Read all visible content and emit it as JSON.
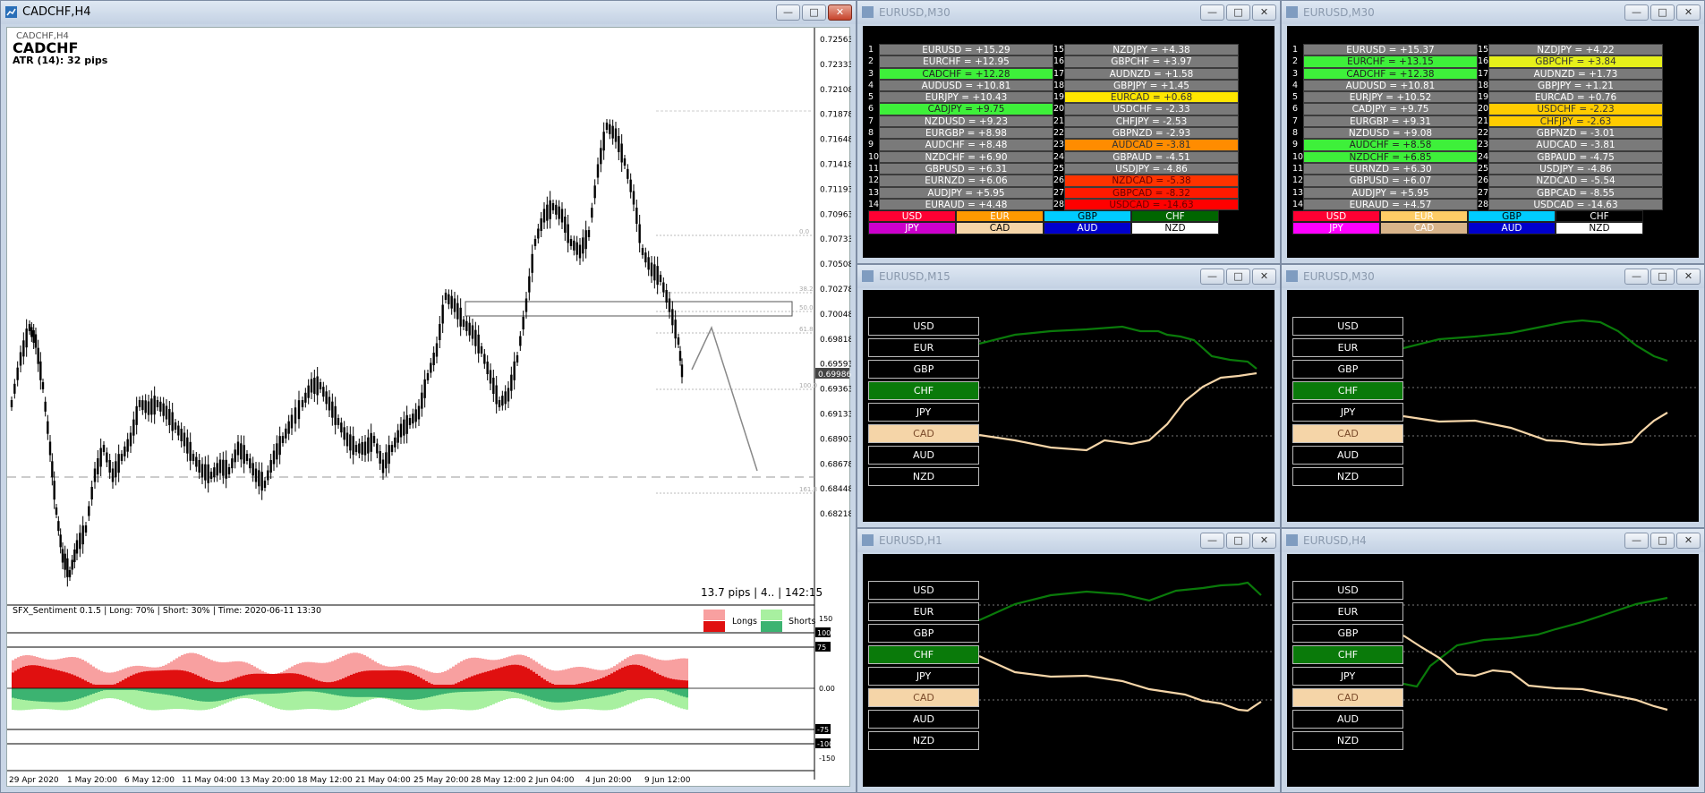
{
  "main": {
    "title": "CADCHF,H4",
    "label_small": "CADCHF,H4",
    "symbol": "CADCHF",
    "atr": "ATR (14): 32 pips",
    "price_axis": [
      "0.72563",
      "0.72333",
      "0.72108",
      "0.71878",
      "0.71648",
      "0.71418",
      "0.71193",
      "0.70963",
      "0.70733",
      "0.70508",
      "0.70278",
      "0.70048",
      "0.69818",
      "0.69593",
      "0.69363",
      "0.69133",
      "0.68903",
      "0.68678",
      "0.68448",
      "0.68218"
    ],
    "current_price": "0.69986",
    "fib_labels": [
      "0.0",
      "38.2",
      "50.0",
      "61.8",
      "100.0",
      "161.8"
    ],
    "info": "13.7 pips | 4.. | 142:15",
    "sentiment_title": "SFX_Sentiment 0.1.5 | Long: 70% | Short: 30% | Time: 2020-06-11 13:30",
    "legend_longs": "Longs",
    "legend_shorts": "Shorts",
    "sent_axis": [
      "150",
      "100",
      "75",
      "0.00",
      "-75",
      "-100",
      "-150"
    ],
    "dates": [
      "29 Apr 2020",
      "1 May 20:00",
      "6 May 12:00",
      "11 May 04:00",
      "13 May 20:00",
      "18 May 12:00",
      "21 May 04:00",
      "25 May 20:00",
      "28 May 12:00",
      "2 Jun 04:00",
      "4 Jun 20:00",
      "9 Jun 12:00"
    ]
  },
  "win1": {
    "title": "EURUSD,M30",
    "rows": [
      {
        "n": "1",
        "t": "EURUSD = +15.29",
        "c": "#7a7a7a",
        "n2": "15",
        "t2": "NZDJPY = +4.38",
        "c2": "#7a7a7a"
      },
      {
        "n": "2",
        "t": "EURCHF = +12.95",
        "c": "#7a7a7a",
        "n2": "16",
        "t2": "GBPCHF = +3.97",
        "c2": "#7a7a7a"
      },
      {
        "n": "3",
        "t": "CADCHF = +12.28",
        "c": "#3ef03a",
        "n2": "17",
        "t2": "AUDNZD = +1.58",
        "c2": "#7a7a7a"
      },
      {
        "n": "4",
        "t": "AUDUSD = +10.81",
        "c": "#7a7a7a",
        "n2": "18",
        "t2": "GBPJPY = +1.45",
        "c2": "#7a7a7a"
      },
      {
        "n": "5",
        "t": "EURJPY = +10.43",
        "c": "#7a7a7a",
        "n2": "19",
        "t2": "EURCAD = +0.68",
        "c2": "#ffe600"
      },
      {
        "n": "6",
        "t": "CADJPY = +9.75",
        "c": "#3ef03a",
        "n2": "20",
        "t2": "USDCHF = -2.33",
        "c2": "#7a7a7a"
      },
      {
        "n": "7",
        "t": "NZDUSD = +9.23",
        "c": "#7a7a7a",
        "n2": "21",
        "t2": "CHFJPY = -2.53",
        "c2": "#7a7a7a"
      },
      {
        "n": "8",
        "t": "EURGBP = +8.98",
        "c": "#7a7a7a",
        "n2": "22",
        "t2": "GBPNZD = -2.93",
        "c2": "#7a7a7a"
      },
      {
        "n": "9",
        "t": "AUDCHF = +8.48",
        "c": "#7a7a7a",
        "n2": "23",
        "t2": "AUDCAD = -3.81",
        "c2": "#ff8c00"
      },
      {
        "n": "10",
        "t": "NZDCHF = +6.90",
        "c": "#7a7a7a",
        "n2": "24",
        "t2": "GBPAUD = -4.51",
        "c2": "#7a7a7a"
      },
      {
        "n": "11",
        "t": "GBPUSD = +6.31",
        "c": "#7a7a7a",
        "n2": "25",
        "t2": "USDJPY = -4.86",
        "c2": "#7a7a7a"
      },
      {
        "n": "12",
        "t": "EURNZD = +6.06",
        "c": "#7a7a7a",
        "n2": "26",
        "t2": "NZDCAD = -5.38",
        "c2": "#ff3300"
      },
      {
        "n": "13",
        "t": "AUDJPY = +5.95",
        "c": "#7a7a7a",
        "n2": "27",
        "t2": "GBPCAD = -8.32",
        "c2": "#ff1a00"
      },
      {
        "n": "14",
        "t": "EURAUD = +4.48",
        "c": "#7a7a7a",
        "n2": "28",
        "t2": "USDCAD = -14.63",
        "c2": "#ff0000"
      }
    ]
  },
  "win2": {
    "title": "EURUSD,M30",
    "rows": [
      {
        "n": "1",
        "t": "EURUSD = +15.37",
        "c": "#7a7a7a",
        "n2": "15",
        "t2": "NZDJPY = +4.22",
        "c2": "#7a7a7a"
      },
      {
        "n": "2",
        "t": "EURCHF = +13.15",
        "c": "#3ef03a",
        "n2": "16",
        "t2": "GBPCHF = +3.84",
        "c2": "#e6f01a"
      },
      {
        "n": "3",
        "t": "CADCHF = +12.38",
        "c": "#3ef03a",
        "n2": "17",
        "t2": "AUDNZD = +1.73",
        "c2": "#7a7a7a"
      },
      {
        "n": "4",
        "t": "AUDUSD = +10.81",
        "c": "#7a7a7a",
        "n2": "18",
        "t2": "GBPJPY = +1.21",
        "c2": "#7a7a7a"
      },
      {
        "n": "5",
        "t": "EURJPY = +10.52",
        "c": "#7a7a7a",
        "n2": "19",
        "t2": "EURCAD = +0.76",
        "c2": "#7a7a7a"
      },
      {
        "n": "6",
        "t": "CADJPY = +9.75",
        "c": "#7a7a7a",
        "n2": "20",
        "t2": "USDCHF = -2.23",
        "c2": "#ffcc00"
      },
      {
        "n": "7",
        "t": "EURGBP = +9.31",
        "c": "#7a7a7a",
        "n2": "21",
        "t2": "CHFJPY = -2.63",
        "c2": "#ffcc00"
      },
      {
        "n": "8",
        "t": "NZDUSD = +9.08",
        "c": "#7a7a7a",
        "n2": "22",
        "t2": "GBPNZD = -3.01",
        "c2": "#7a7a7a"
      },
      {
        "n": "9",
        "t": "AUDCHF = +8.58",
        "c": "#3ef03a",
        "n2": "23",
        "t2": "AUDCAD = -3.81",
        "c2": "#7a7a7a"
      },
      {
        "n": "10",
        "t": "NZDCHF = +6.85",
        "c": "#3ef03a",
        "n2": "24",
        "t2": "GBPAUD = -4.75",
        "c2": "#7a7a7a"
      },
      {
        "n": "11",
        "t": "EURNZD = +6.30",
        "c": "#7a7a7a",
        "n2": "25",
        "t2": "USDJPY = -4.86",
        "c2": "#7a7a7a"
      },
      {
        "n": "12",
        "t": "GBPUSD = +6.07",
        "c": "#7a7a7a",
        "n2": "26",
        "t2": "NZDCAD = -5.54",
        "c2": "#7a7a7a"
      },
      {
        "n": "13",
        "t": "AUDJPY = +5.95",
        "c": "#7a7a7a",
        "n2": "27",
        "t2": "GBPCAD = -8.55",
        "c2": "#7a7a7a"
      },
      {
        "n": "14",
        "t": "EURAUD = +4.57",
        "c": "#7a7a7a",
        "n2": "28",
        "t2": "USDCAD = -14.63",
        "c2": "#7a7a7a"
      }
    ]
  },
  "currency_row1": [
    {
      "label": "USD",
      "bg": "#ff0033",
      "fg": "#ffffff"
    },
    {
      "label": "EUR",
      "bg": "#ff9900",
      "fg": "#ffffff"
    },
    {
      "label": "GBP",
      "bg": "#00ccff",
      "fg": "#000000"
    },
    {
      "label": "CHF",
      "bg": "#006600",
      "fg": "#ffffff"
    }
  ],
  "currency_row2": [
    {
      "label": "JPY",
      "bg": "#cc00cc",
      "fg": "#ffffff"
    },
    {
      "label": "CAD",
      "bg": "#f5d5a8",
      "fg": "#000000"
    },
    {
      "label": "AUD",
      "bg": "#0000cc",
      "fg": "#ffffff"
    },
    {
      "label": "NZD",
      "bg": "#ffffff",
      "fg": "#000000"
    }
  ],
  "currency_row1_dim": [
    {
      "label": "USD",
      "bg": "#ff0033",
      "fg": "#ffffff"
    },
    {
      "label": "EUR",
      "bg": "#ffcc66",
      "fg": "#ffffff"
    },
    {
      "label": "GBP",
      "bg": "#00ccff",
      "fg": "#000000"
    },
    {
      "label": "CHF",
      "bg": "#000000",
      "fg": "#ffffff"
    }
  ],
  "currency_row2_dim": [
    {
      "label": "JPY",
      "bg": "#ff00ff",
      "fg": "#ffffff"
    },
    {
      "label": "CAD",
      "bg": "#d8b48a",
      "fg": "#ffffff"
    },
    {
      "label": "AUD",
      "bg": "#0000cc",
      "fg": "#ffffff"
    },
    {
      "label": "NZD",
      "bg": "#ffffff",
      "fg": "#000000"
    }
  ],
  "strength_currencies": [
    "USD",
    "EUR",
    "GBP",
    "CHF",
    "JPY",
    "CAD",
    "AUD",
    "NZD"
  ],
  "win3": {
    "title": "EURUSD,M15"
  },
  "win4": {
    "title": "EURUSD,M30"
  },
  "win5": {
    "title": "EURUSD,H1"
  },
  "win6": {
    "title": "EURUSD,H4"
  },
  "chart_data": {
    "type": "line",
    "series_color": {
      "CHF": "#0a7a0a",
      "CAD": "#f5d5a8"
    }
  }
}
